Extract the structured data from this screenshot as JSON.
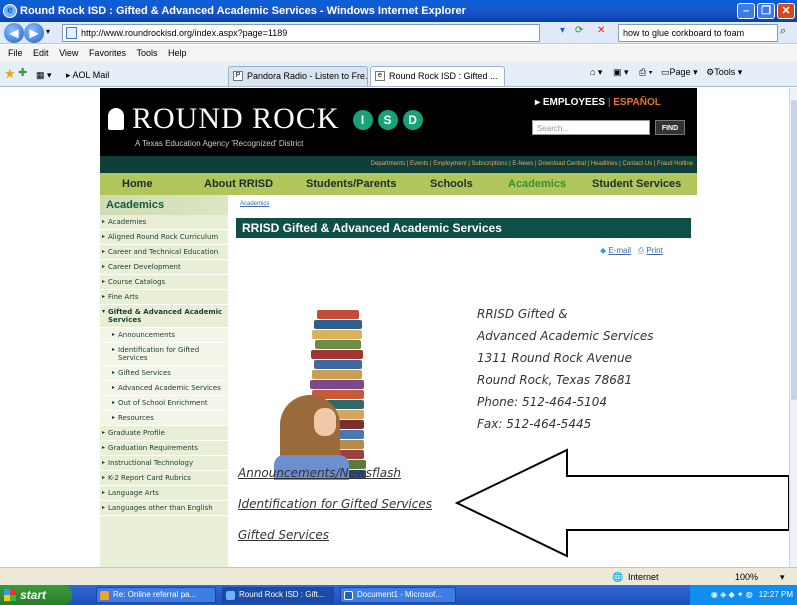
{
  "window": {
    "title": "Round Rock ISD : Gifted & Advanced Academic Services - Windows Internet Explorer"
  },
  "address_bar": {
    "url": "http://www.roundrockisd.org/index.aspx?page=1189",
    "search_value": "how to glue corkboard to foam"
  },
  "menu": [
    "File",
    "Edit",
    "View",
    "Favorites",
    "Tools",
    "Help"
  ],
  "favorites": {
    "label": "AOL Mail"
  },
  "tabs": [
    {
      "label": "Pandora Radio - Listen to Fre..."
    },
    {
      "label": "Round Rock ISD : Gifted ...",
      "close": "X"
    }
  ],
  "command_bar": {
    "page": "Page",
    "tools": "Tools"
  },
  "site": {
    "logo_text": "ROUND ROCK",
    "logo_letters": [
      "I",
      "S",
      "D"
    ],
    "tagline": "A Texas Education Agency 'Recognized' District",
    "employees": "EMPLOYEES",
    "espanol": "ESPAÑOL",
    "search_placeholder": "Search...",
    "find": "FIND",
    "top_links": "Departments | Events | Employment | Subscriptions | E-News | Download Central | Headlines | Contact Us | Fraud Hotline",
    "main_nav": [
      "Home",
      "About RRISD",
      "Students/Parents",
      "Schools",
      "Academics",
      "Student Services"
    ]
  },
  "sidebar": {
    "heading": "Academics",
    "items": [
      {
        "label": "Academies"
      },
      {
        "label": "Aligned Round Rock Curriculum"
      },
      {
        "label": "Career and Technical Education"
      },
      {
        "label": "Career Development"
      },
      {
        "label": "Course Catalogs"
      },
      {
        "label": "Fine Arts"
      },
      {
        "label": "Gifted & Advanced Academic Services"
      },
      {
        "label": "Announcements"
      },
      {
        "label": "Identification for Gifted Services"
      },
      {
        "label": "Gifted Services"
      },
      {
        "label": "Advanced Academic Services"
      },
      {
        "label": "Out of School Enrichment"
      },
      {
        "label": "Resources"
      },
      {
        "label": "Graduate Profile"
      },
      {
        "label": "Graduation Requirements"
      },
      {
        "label": "Instructional Technology"
      },
      {
        "label": "K-2 Report Card Rubrics"
      },
      {
        "label": "Language Arts"
      },
      {
        "label": "Languages other than English"
      }
    ]
  },
  "content": {
    "breadcrumb": "Academics",
    "title": "RRISD Gifted & Advanced Academic Services",
    "email": "E-mail",
    "print": "Print",
    "address_lines": [
      "RRISD Gifted &",
      "Advanced Academic Services",
      "1311 Round Rock Avenue",
      "Round Rock, Texas 78681",
      "Phone: 512-464-5104",
      "Fax: 512-464-5445"
    ],
    "links": [
      "Announcements/Newsflash",
      "Identification for Gifted Services",
      "Gifted Services"
    ]
  },
  "status": {
    "zone": "Internet",
    "zoom": "100%"
  },
  "taskbar": {
    "start": "start",
    "buttons": [
      "Re: Online referral pa...",
      "Round Rock ISD : Gift...",
      "Document1 - Microsof..."
    ],
    "clock": "12:27 PM"
  }
}
